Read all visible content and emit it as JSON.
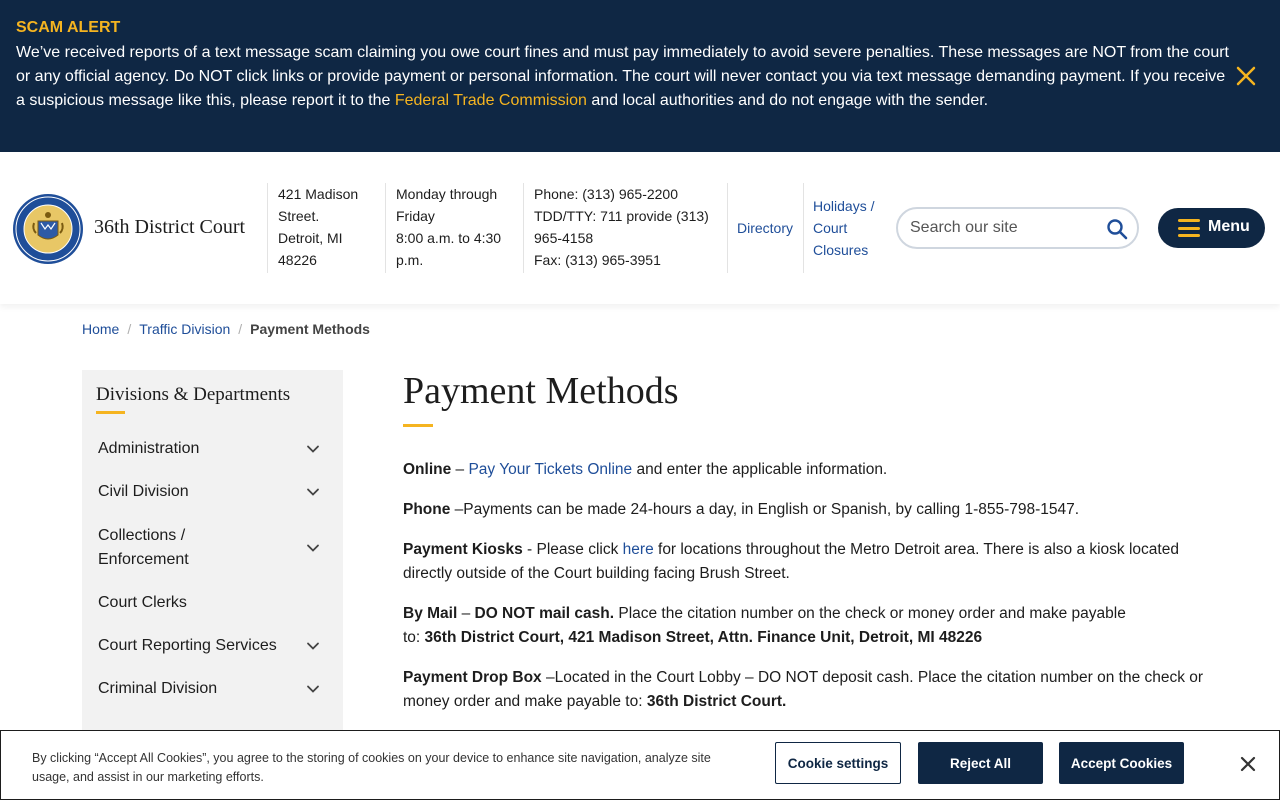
{
  "alert": {
    "title": "SCAM ALERT",
    "text_before": "We’ve received reports of a text message scam claiming you owe court fines and must pay immediately to avoid severe penalties. These messages are NOT from the court or any official agency. Do NOT click links or provide payment or personal information. The court will never contact you via text message demanding payment. If you receive a suspicious message like this, please report it to the ",
    "link": "Federal Trade Commission",
    "text_after": " and local authorities and do not engage with the sender.",
    "accent_color": "#f5b420",
    "background": "#0f2744"
  },
  "header": {
    "site_name": "36th District Court",
    "address": [
      "421 Madison",
      "Street.",
      "Detroit, MI",
      "48226"
    ],
    "hours": [
      "Monday through",
      "Friday",
      "8:00 a.m. to 4:30",
      "p.m."
    ],
    "phone": [
      "Phone: (313) 965-2200",
      "TDD/TTY: 711 provide (313)",
      "965-4158",
      "Fax: (313) 965-3951"
    ],
    "directory": "Directory",
    "holidays": [
      "Holidays /",
      "Court",
      "Closures"
    ],
    "search_placeholder": "Search our site",
    "menu_label": "Menu"
  },
  "breadcrumb": {
    "home": "Home",
    "parent": "Traffic Division",
    "current": "Payment Methods"
  },
  "sidebar": {
    "title": "Divisions & Departments",
    "items": [
      {
        "label": "Administration",
        "expandable": true
      },
      {
        "label": "Civil Division",
        "expandable": true
      },
      {
        "label": "Collections / Enforcement",
        "expandable": true
      },
      {
        "label": "Court Clerks",
        "expandable": false
      },
      {
        "label": "Court Reporting Services",
        "expandable": true
      },
      {
        "label": "Criminal Division",
        "expandable": true
      }
    ]
  },
  "main": {
    "title": "Payment Methods",
    "online": {
      "label": "Online",
      "dash": " – ",
      "link": "Pay Your Tickets Online",
      "rest": " and enter the applicable information."
    },
    "phone": {
      "label": "Phone",
      "rest": " –Payments can be made 24-hours a day, in English or Spanish, by calling 1-855-798-1547."
    },
    "kiosks": {
      "label": "Payment Kiosks",
      "pre": " - Please click ",
      "link": "here",
      "rest": " for locations throughout the Metro Detroit area. There is also a kiosk located directly outside of the Court building facing Brush Street."
    },
    "mail": {
      "label": "By Mail",
      "dash": " – ",
      "bold1": "DO NOT mail cash.",
      "mid": "  Place the citation number on the check or money order and make payable to:  ",
      "bold2": "36th District Court, 421 Madison Street, Attn. Finance Unit, Detroit, MI   48226"
    },
    "dropbox": {
      "label": "Payment Drop Box",
      "mid": " –Located in the Court Lobby – DO NOT deposit cash.  Place the citation number on the check or money order and make payable to:  ",
      "bold": "36th District Court."
    }
  },
  "cookie": {
    "text": "By clicking “Accept All Cookies”, you agree to the storing of cookies on your device to enhance site navigation, analyze site usage, and assist in our marketing efforts.",
    "settings": "Cookie settings",
    "reject": "Reject All",
    "accept": "Accept Cookies"
  }
}
